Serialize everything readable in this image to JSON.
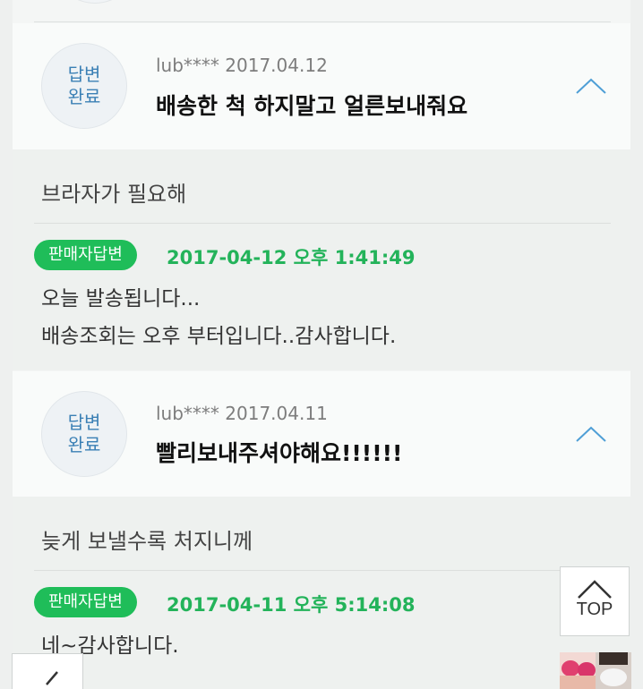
{
  "status_badge": {
    "line1": "답변",
    "line2": "완료"
  },
  "questions": [
    {
      "meta": "lub**** 2017.04.12",
      "title": "배송한 척 하지말고 얼른보내줘요",
      "body": "브라자가 필요해",
      "seller_label": "판매자답변",
      "reply_date": "2017-04-12 오후 1:41:49",
      "reply_text": "오늘 발송됩니다...\n배송조회는 오후 부터입니다..감사합니다."
    },
    {
      "meta": "lub**** 2017.04.11",
      "title": "빨리보내주셔야해요!!!!!!",
      "body": "늦게 보낼수록 처지니께",
      "seller_label": "판매자답변",
      "reply_date": "2017-04-11 오후 5:14:08",
      "reply_text": "네~감사합니다."
    }
  ],
  "top_button": {
    "label": "TOP",
    "icon": "chevron-up-icon"
  },
  "back_button": {
    "icon": "back-arrow-icon"
  },
  "colors": {
    "accent_green": "#1fbd59",
    "badge_blue": "#3b80b5",
    "chevron_blue": "#4f9fd6"
  }
}
